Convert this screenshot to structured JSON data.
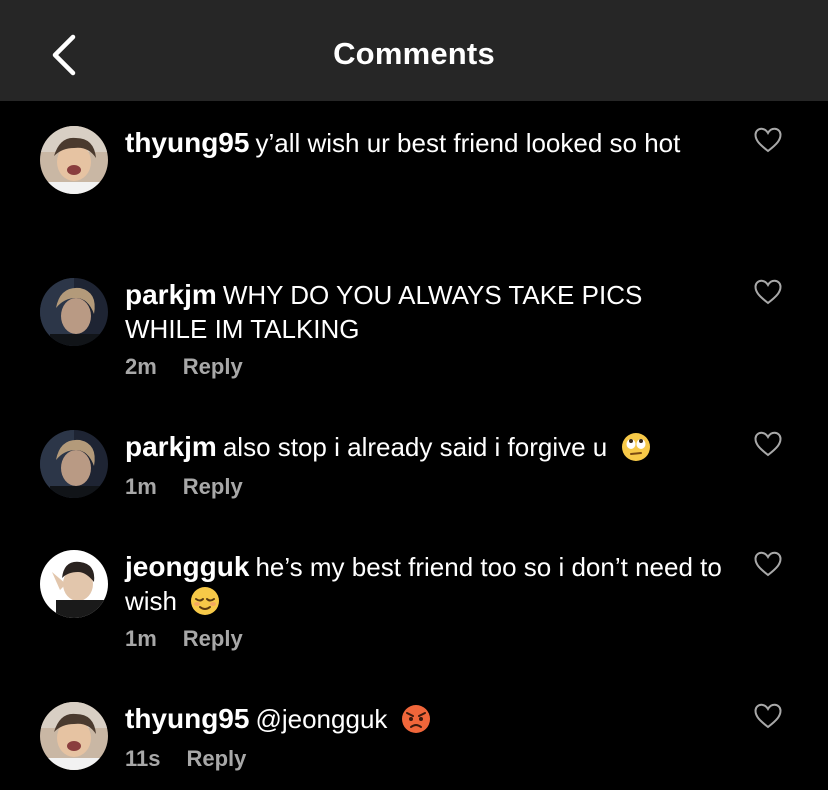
{
  "header": {
    "title": "Comments",
    "back_icon": "chevron-left-icon"
  },
  "colors": {
    "header_bg": "#262626",
    "bg": "#000000",
    "text": "#ffffff",
    "meta": "#a8a8a8"
  },
  "comments": [
    {
      "username": "thyung95",
      "text": "y’all wish ur best friend looked so hot",
      "emoji": "",
      "time": "",
      "reply": ""
    },
    {
      "username": "parkjm",
      "text": "WHY DO YOU ALWAYS TAKE PICS WHILE IM TALKING",
      "emoji": "",
      "time": "2m",
      "reply": "Reply"
    },
    {
      "username": "parkjm",
      "text": "also stop i already said i forgive u",
      "emoji": "face-with-rolling-eyes",
      "time": "1m",
      "reply": "Reply"
    },
    {
      "username": "jeongguk",
      "text": "he’s my best friend too so i don’t need to wish",
      "emoji": "relieved-face",
      "time": "1m",
      "reply": "Reply"
    },
    {
      "username": "thyung95",
      "text": "@jeongguk",
      "emoji": "angry-face",
      "time": "11s",
      "reply": "Reply"
    }
  ]
}
